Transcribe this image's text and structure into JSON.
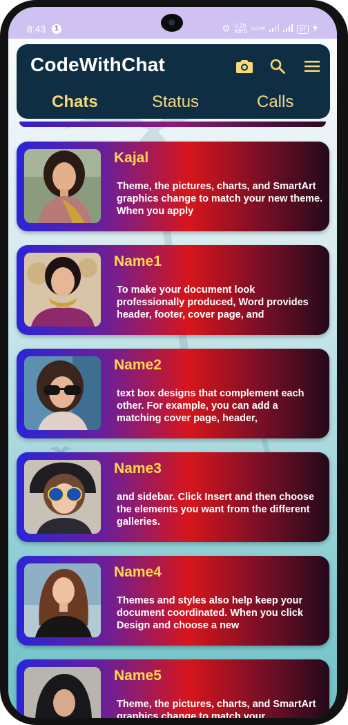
{
  "status_bar": {
    "time": "8:43",
    "notification_count": "1",
    "net_speed_value": "0.29",
    "net_speed_unit": "KB/S",
    "network": "VoLTE",
    "battery": "97"
  },
  "app": {
    "title": "CodeWithChat",
    "tabs": [
      {
        "label": "Chats",
        "active": true
      },
      {
        "label": "Status",
        "active": false
      },
      {
        "label": "Calls",
        "active": false
      }
    ],
    "icons": [
      "camera-icon",
      "search-icon",
      "menu-icon"
    ]
  },
  "colors": {
    "status_bar": "#cfc2f2",
    "app_bar": "#0f2e43",
    "tab_text": "#f6d978",
    "card_name": "#ffd94a",
    "card_gradient_start": "#2a25d8",
    "card_gradient_mid": "#d6161c",
    "card_gradient_end": "#24091a"
  },
  "chats": [
    {
      "name": "Kajal",
      "message": "Theme, the pictures, charts, and SmartArt graphics change to match your new theme. When you apply"
    },
    {
      "name": "Name1",
      "message": "To make your document look professionally produced, Word provides header, footer, cover page, and"
    },
    {
      "name": "Name2",
      "message": "text box designs that complement each other. For example, you can add a matching cover page, header,"
    },
    {
      "name": "Name3",
      "message": "and sidebar. Click Insert and then choose the elements you want from the different galleries."
    },
    {
      "name": "Name4",
      "message": "Themes and styles also help keep your document coordinated. When you click Design and choose a new"
    },
    {
      "name": "Name5",
      "message": "Theme, the pictures, charts, and SmartArt graphics change to match your"
    }
  ]
}
